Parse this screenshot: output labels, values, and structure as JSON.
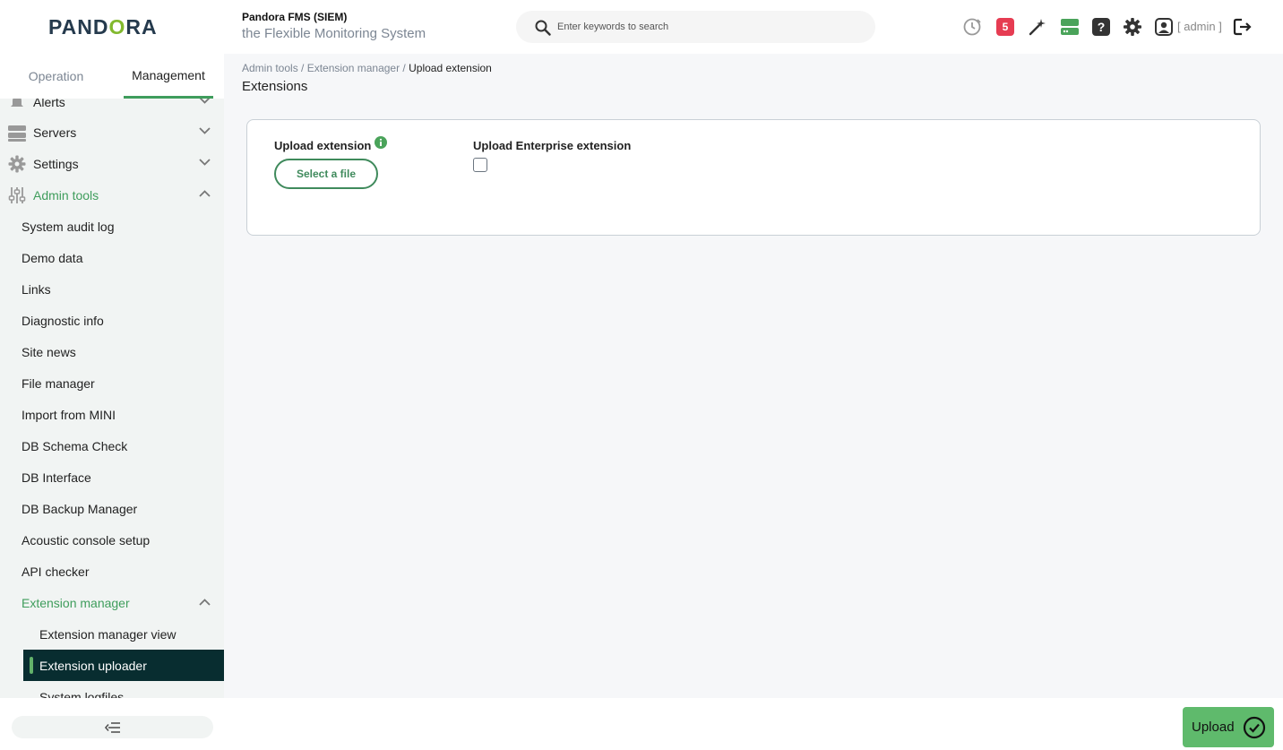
{
  "header": {
    "logo_text_1": "PAND",
    "logo_text_o": "O",
    "logo_text_2": "RA",
    "app_name": "Pandora FMS (SIEM)",
    "app_subtitle": "the Flexible Monitoring System",
    "search_placeholder": "Enter keywords to search",
    "notification_count": "5",
    "help_glyph": "?",
    "user_label": "[ admin ]",
    "icons": [
      "history-icon",
      "wizard-icon",
      "server-status-icon",
      "help-icon",
      "settings-icon",
      "user-icon",
      "logout-icon"
    ]
  },
  "sidebar": {
    "tabs": [
      "Operation",
      "Management"
    ],
    "active_tab": "Management",
    "menu": [
      {
        "label": "Alerts",
        "icon": "bell-icon"
      },
      {
        "label": "Servers",
        "icon": "server-icon"
      },
      {
        "label": "Settings",
        "icon": "gear-icon"
      },
      {
        "label": "Admin tools",
        "icon": "sliders-icon"
      }
    ],
    "admin_tools_items": [
      "System audit log",
      "Demo data",
      "Links",
      "Diagnostic info",
      "Site news",
      "File manager",
      "Import from MINI",
      "DB Schema Check",
      "DB Interface",
      "DB Backup Manager",
      "Acoustic console setup",
      "API checker",
      "Extension manager"
    ],
    "extension_manager_items": [
      "Extension manager view",
      "Extension uploader",
      "System logfiles"
    ],
    "active_item": "Extension uploader",
    "accent_color": "#3f9d5c"
  },
  "breadcrumb": {
    "items": [
      "Admin tools / ",
      "Extension manager / "
    ],
    "current": "Upload extension"
  },
  "page": {
    "title": "Extensions",
    "upload_label": "Upload extension",
    "select_file_label": "Select a file",
    "enterprise_label": "Upload Enterprise extension",
    "enterprise_checked": false
  },
  "footer": {
    "upload_label": "Upload",
    "upload_color": "#5fba6c"
  }
}
